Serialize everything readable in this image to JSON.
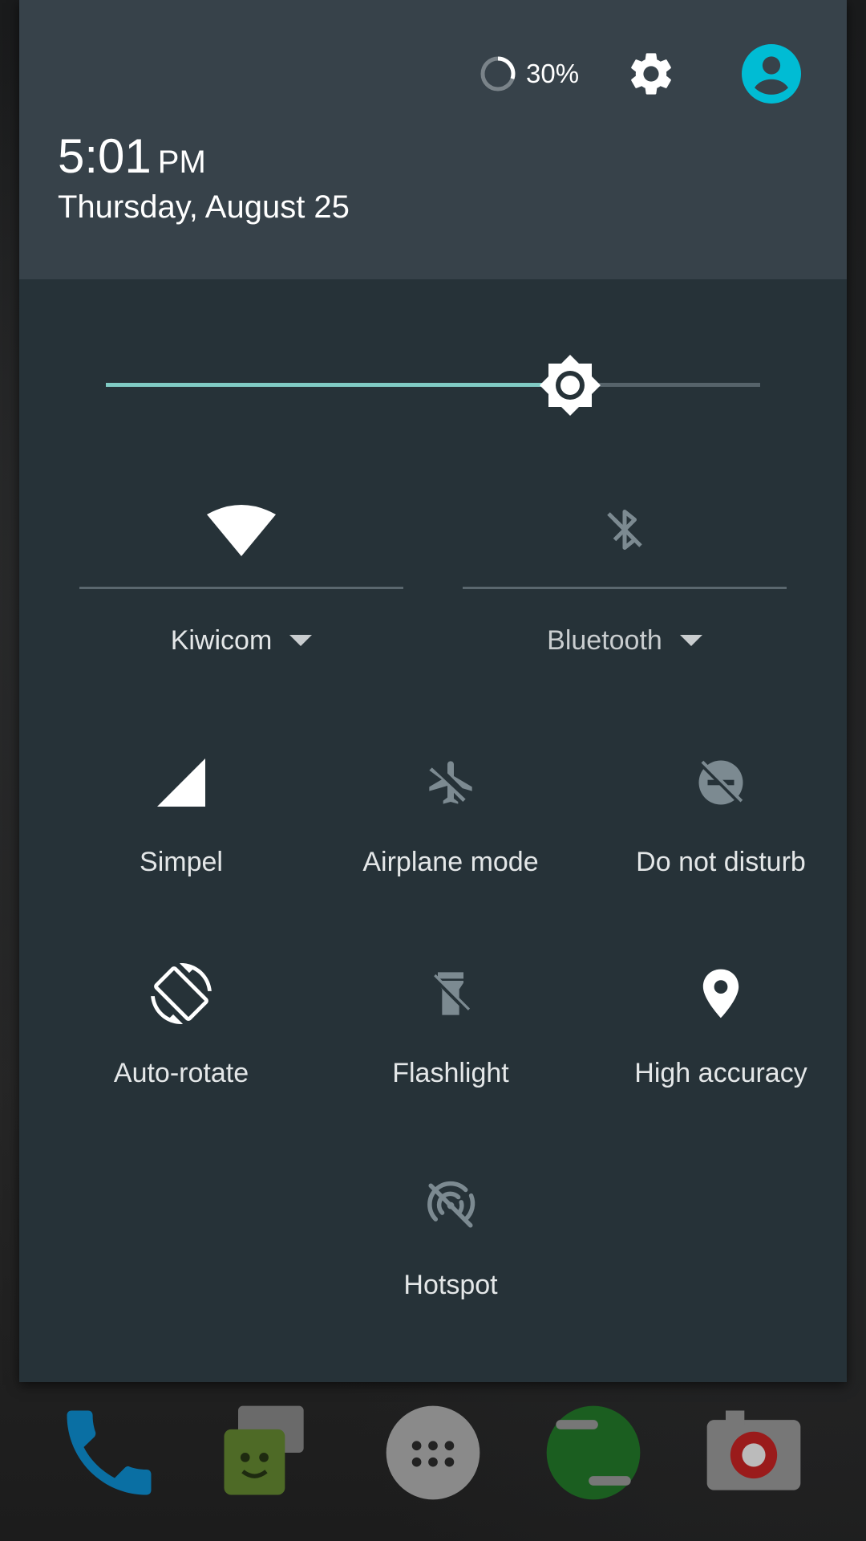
{
  "status": {
    "battery_percent": "30%",
    "battery_level": 0.3
  },
  "clock": {
    "time": "5:01",
    "ampm": "PM",
    "date": "Thursday, August 25"
  },
  "brightness": {
    "level": 0.71
  },
  "tiles_wide": [
    {
      "label": "Kiwicom",
      "icon": "wifi-icon",
      "active": true
    },
    {
      "label": "Bluetooth",
      "icon": "bluetooth-off-icon",
      "active": false
    }
  ],
  "tiles": [
    {
      "label": "Simpel",
      "icon": "cell-signal-icon",
      "active": true
    },
    {
      "label": "Airplane mode",
      "icon": "airplane-off-icon",
      "active": false
    },
    {
      "label": "Do not disturb",
      "icon": "do-not-disturb-off-icon",
      "active": false
    },
    {
      "label": "Auto-rotate",
      "icon": "auto-rotate-icon",
      "active": true
    },
    {
      "label": "Flashlight",
      "icon": "flashlight-off-icon",
      "active": false
    },
    {
      "label": "High accuracy",
      "icon": "location-icon",
      "active": true
    },
    {
      "label": "Hotspot",
      "icon": "hotspot-off-icon",
      "active": false
    }
  ],
  "colors": {
    "shade_bg": "#263238",
    "header_bg": "#37424a",
    "accent": "#80cbc4",
    "avatar": "#00bcd4",
    "icon_active": "#ffffff",
    "icon_inactive": "#7c8a91"
  },
  "dock": [
    {
      "icon": "phone-icon"
    },
    {
      "icon": "messenger-icon"
    },
    {
      "icon": "app-drawer-icon"
    },
    {
      "icon": "hangouts-icon"
    },
    {
      "icon": "camera-icon"
    }
  ]
}
